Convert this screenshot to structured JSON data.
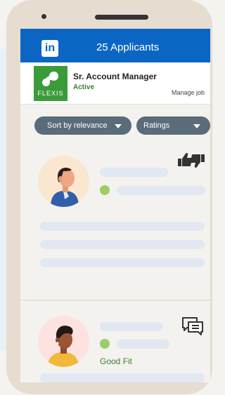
{
  "header": {
    "logo_text": "in",
    "title": "25 Applicants"
  },
  "job": {
    "company_logo_text": "FLEXIS",
    "title": "Sr. Account Manager",
    "status": "Active",
    "manage_label": "Manage job"
  },
  "filters": {
    "sort_label": "Sort by relevance",
    "ratings_label": "Ratings"
  },
  "applicants": [
    {
      "fit_label": "",
      "action_icon": "thumbs-up-down-icon"
    },
    {
      "fit_label": "Good Fit",
      "action_icon": "message-icon"
    }
  ],
  "colors": {
    "brand": "#0a66c2",
    "company": "#3b9b3b",
    "status": "#3d7f2d",
    "pill": "#5a6b79",
    "online": "#9ccc65"
  }
}
